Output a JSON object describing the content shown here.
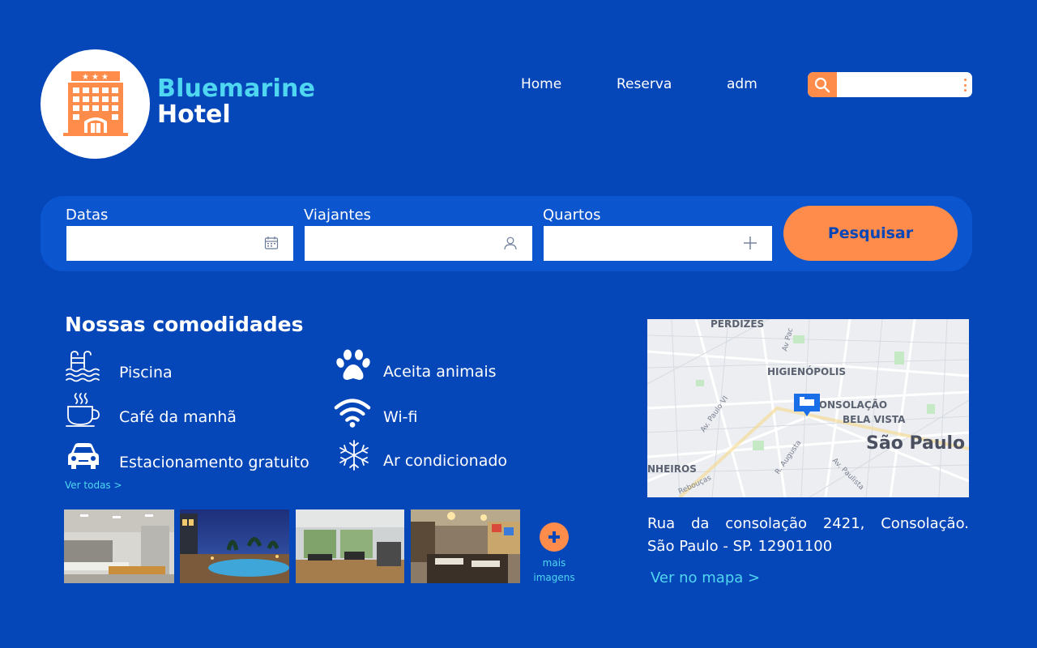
{
  "brand": {
    "line1": "Bluemarine",
    "line2": "Hotel",
    "logo_icon": "hotel-building-icon"
  },
  "nav": {
    "home": "Home",
    "reserva": "Reserva",
    "adm": "adm"
  },
  "search": {
    "placeholder": "",
    "value": ""
  },
  "booking": {
    "dates_label": "Datas",
    "travelers_label": "Viajantes",
    "rooms_label": "Quartos",
    "search_button": "Pesquisar"
  },
  "amenities": {
    "title": "Nossas comodidades",
    "items": [
      {
        "label": "Piscina",
        "icon": "pool-icon"
      },
      {
        "label": "Café da manhã",
        "icon": "coffee-cup-icon"
      },
      {
        "label": "Estacionamento gratuito",
        "icon": "car-icon"
      },
      {
        "label": "Aceita animais",
        "icon": "paw-icon"
      },
      {
        "label": "Wi-fi",
        "icon": "wifi-icon"
      },
      {
        "label": "Ar condicionado",
        "icon": "snowflake-icon"
      }
    ],
    "see_all": "Ver todas >"
  },
  "gallery": {
    "more_line1": "mais",
    "more_line2": "imagens"
  },
  "location": {
    "map_labels": {
      "perdizes": "PERDIZES",
      "higienopolis": "HIGIENÓPOLIS",
      "consolacao": "CONSOLAÇÃO",
      "bela_vista": "BELA VISTA",
      "sao_paulo": "São Paulo",
      "pinheiros": "NHEIROS",
      "av_pacaembu": "Av Pac",
      "av_paulo_vi": "Av. Paulo VI",
      "r_augusta": "R. Augusta",
      "av_paulista": "Av. Paulista",
      "reboucas": "Rebouças"
    },
    "address_line1": "Rua da consolação 2421, Consolação.",
    "address_line2": "São Paulo - SP. 12901100",
    "map_link": "Ver no mapa >"
  },
  "colors": {
    "background": "#0546b8",
    "accent_orange": "#ff8c4a",
    "accent_cyan": "#4fd7f2",
    "bar": "#0b55cf"
  }
}
